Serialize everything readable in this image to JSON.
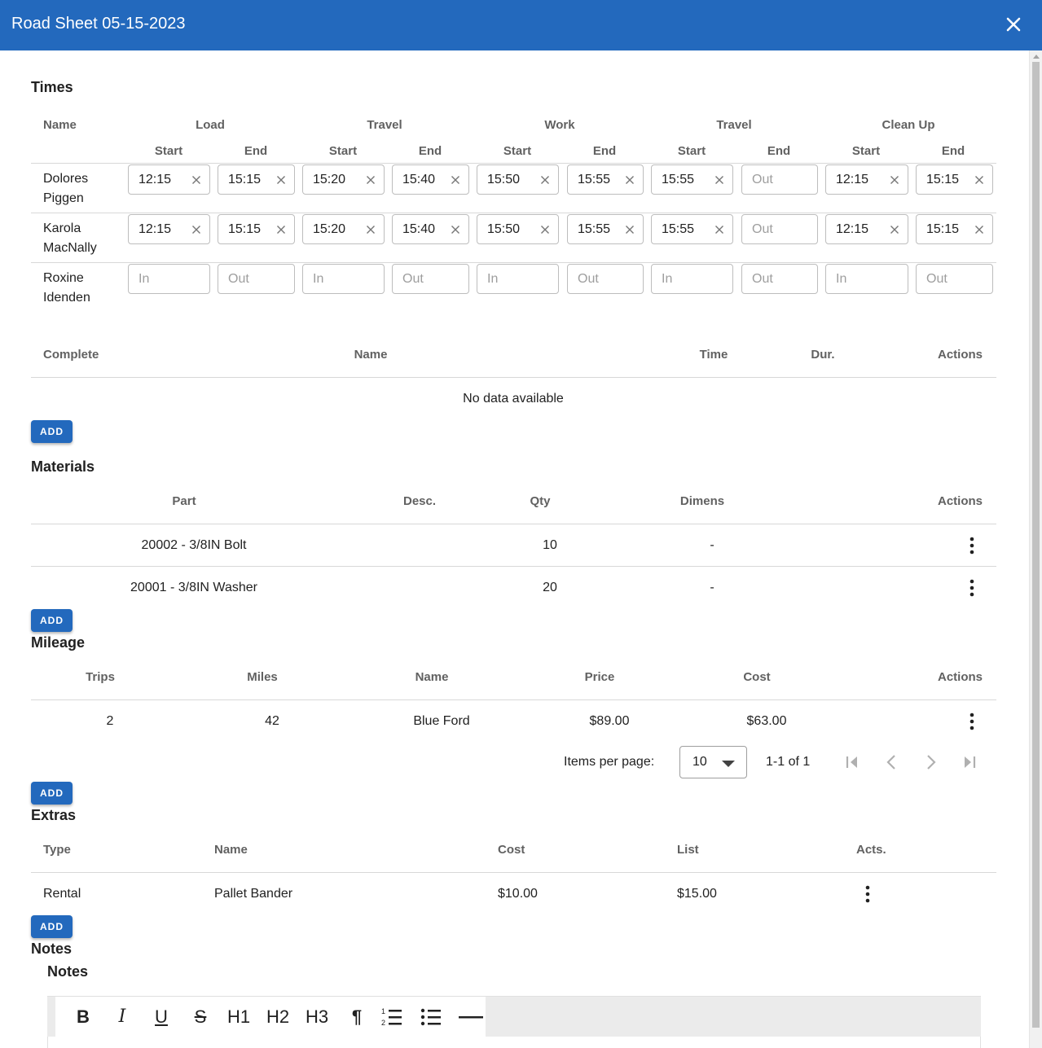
{
  "dialog": {
    "title": "Road Sheet 05-15-2023"
  },
  "times": {
    "title": "Times",
    "name_header": "Name",
    "groups": [
      "Load",
      "Travel",
      "Work",
      "Travel",
      "Clean Up"
    ],
    "start_label": "Start",
    "end_label": "End",
    "rows": [
      {
        "name_line1": "Dolores",
        "name_line2": "Piggen",
        "values": [
          "12:15",
          "15:15",
          "15:20",
          "15:40",
          "15:50",
          "15:55",
          "15:55",
          "",
          "12:15",
          "15:15"
        ]
      },
      {
        "name_line1": "Karola",
        "name_line2": "MacNally",
        "values": [
          "12:15",
          "15:15",
          "15:20",
          "15:40",
          "15:50",
          "15:55",
          "15:55",
          "",
          "12:15",
          "15:15"
        ]
      },
      {
        "name_line1": "Roxine",
        "name_line2": "Idenden",
        "values": [
          "",
          "",
          "",
          "",
          "",
          "",
          "",
          "",
          "",
          ""
        ]
      }
    ],
    "placeholder_in": "In",
    "placeholder_out": "Out"
  },
  "tasks": {
    "headers": {
      "complete": "Complete",
      "name": "Name",
      "time": "Time",
      "dur": "Dur.",
      "actions": "Actions"
    },
    "empty": "No data available",
    "add_label": "ADD"
  },
  "materials": {
    "title": "Materials",
    "headers": {
      "part": "Part",
      "desc": "Desc.",
      "qty": "Qty",
      "dimens": "Dimens",
      "actions": "Actions"
    },
    "rows": [
      {
        "part": "20002 - 3/8IN Bolt",
        "qty": "10",
        "dimens": "-"
      },
      {
        "part": "20001 - 3/8IN Washer",
        "qty": "20",
        "dimens": "-"
      }
    ],
    "add_label": "ADD"
  },
  "mileage": {
    "title": "Mileage",
    "headers": {
      "trips": "Trips",
      "miles": "Miles",
      "name": "Name",
      "price": "Price",
      "cost": "Cost",
      "actions": "Actions"
    },
    "rows": [
      {
        "trips": "2",
        "miles": "42",
        "name": "Blue Ford",
        "price": "$89.00",
        "cost": "$63.00"
      }
    ],
    "pagination": {
      "items_per_page_label": "Items per page:",
      "per_page": "10",
      "range": "1-1 of 1"
    },
    "add_label": "ADD"
  },
  "extras": {
    "title": "Extras",
    "headers": {
      "type": "Type",
      "name": "Name",
      "cost": "Cost",
      "list": "List",
      "acts": "Acts."
    },
    "rows": [
      {
        "type": "Rental",
        "name": "Pallet Bander",
        "cost": "$10.00",
        "list": "$15.00"
      }
    ],
    "add_label": "ADD"
  },
  "notes": {
    "title": "Notes",
    "label": "Notes",
    "toolbar": [
      "B",
      "I",
      "U",
      "S",
      "H1",
      "H2",
      "H3",
      "¶",
      "ordered-list",
      "bullet-list",
      "horizontal-rule"
    ]
  },
  "colors": {
    "primary": "#2369bd",
    "header_text": "#616161",
    "border": "#bdbdbd"
  }
}
